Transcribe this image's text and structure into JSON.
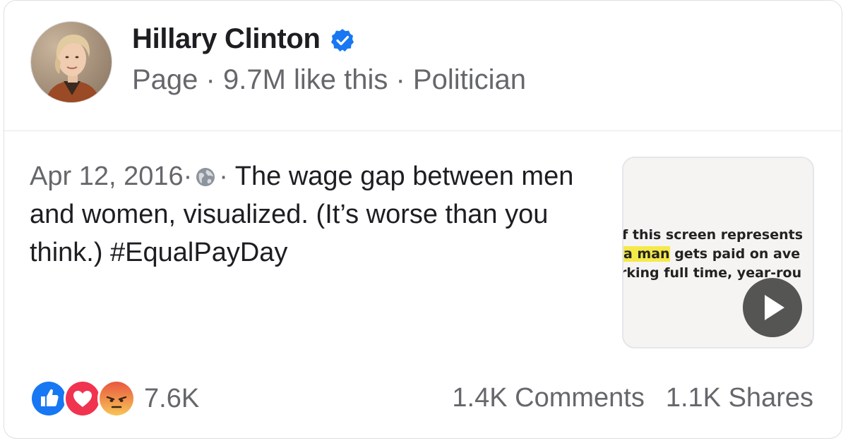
{
  "header": {
    "page_name": "Hillary Clinton",
    "meta": "Page · 9.7M like this · Politician"
  },
  "post": {
    "date": "Apr 12, 2016",
    "separator": "·",
    "text": "The wage gap between men and women, visualized. (It’s worse than you think.) #EqualPayDay",
    "privacy_icon": "globe-icon"
  },
  "video_thumbnail": {
    "line1": "f this screen represents",
    "line2_highlight": "a man",
    "line2_rest": " gets paid on ave",
    "line3": "rking full time, year-rou",
    "highlight_color": "#f5e94a"
  },
  "footer": {
    "reaction_icons": [
      "like-icon",
      "love-icon",
      "angry-icon"
    ],
    "reaction_count": "7.6K",
    "comments": "1.4K Comments",
    "shares": "1.1K Shares"
  },
  "colors": {
    "verified_blue": "#1877f2",
    "like_blue": "#1877f2",
    "love_red": "#f0334f",
    "angry_orange": "#f7a046",
    "secondary_text": "#65676b"
  }
}
